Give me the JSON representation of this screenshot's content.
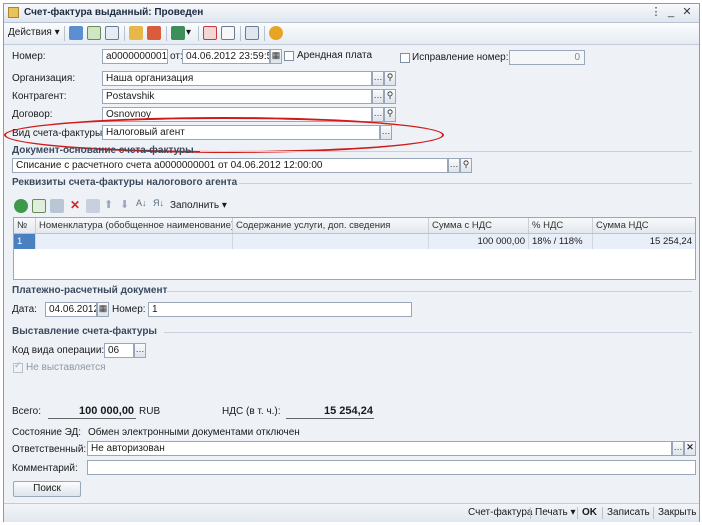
{
  "window": {
    "title": "Счет-фактура выданный: Проведен"
  },
  "toolbar": {
    "actions_label": "Действия",
    "fill_label": "Заполнить"
  },
  "form": {
    "number_label": "Номер:",
    "number_value": "а0000000001",
    "from_label": "от:",
    "date_value": "04.06.2012 23:59:59",
    "rent_label": "Арендная плата",
    "correction_label": "Исправление номер:",
    "correction_value": "0",
    "org_label": "Организация:",
    "org_value": "Наша организация",
    "contractor_label": "Контрагент:",
    "contractor_value": "Postavshik",
    "contract_label": "Договор:",
    "contract_value": "Osnovnoy",
    "invoice_type_label": "Вид счета-фактуры:",
    "invoice_type_value": "Налоговый агент"
  },
  "basis": {
    "section_label": "Документ-основание счета-фактуры",
    "value": "Списание с расчетного счета а0000000001 от 04.06.2012 12:00:00"
  },
  "agent_section": {
    "label": "Реквизиты счета-фактуры налогового агента"
  },
  "table": {
    "headers": [
      "№",
      "Номенклатура (обобщенное наименование)",
      "Содержание услуги, доп. сведения",
      "Сумма с НДС",
      "% НДС",
      "Сумма НДС"
    ],
    "rows": [
      {
        "n": "1",
        "item": "",
        "content": "",
        "sum": "100 000,00",
        "vat_rate": "18% / 118%",
        "vat_sum": "15 254,24"
      }
    ]
  },
  "payment": {
    "section_label": "Платежно-расчетный документ",
    "date_label": "Дата:",
    "date_value": "04.06.2012",
    "number_label": "Номер:",
    "number_value": "1"
  },
  "issue": {
    "section_label": "Выставление счета-фактуры",
    "op_code_label": "Код вида операции:",
    "op_code_value": "06",
    "not_issued_label": "Не выставляется"
  },
  "totals": {
    "total_label": "Всего:",
    "total_value": "100 000,00",
    "currency": "RUB",
    "vat_label": "НДС (в т. ч.):",
    "vat_value": "15 254,24"
  },
  "ed": {
    "label": "Состояние ЭД:",
    "value": "Обмен электронными документами отключен"
  },
  "responsible": {
    "label": "Ответственный:",
    "value": "Не авторизован"
  },
  "comment": {
    "label": "Комментарий:",
    "value": ""
  },
  "search_button": "Поиск",
  "bottom": {
    "invoice": "Счет-фактура",
    "print": "Печать",
    "ok": "OK",
    "save": "Записать",
    "close": "Закрыть"
  },
  "colors": {
    "highlight_ellipse": "#d21a1a",
    "selected_cell": "#4a7fc1",
    "section_text": "#3a4a5e"
  }
}
